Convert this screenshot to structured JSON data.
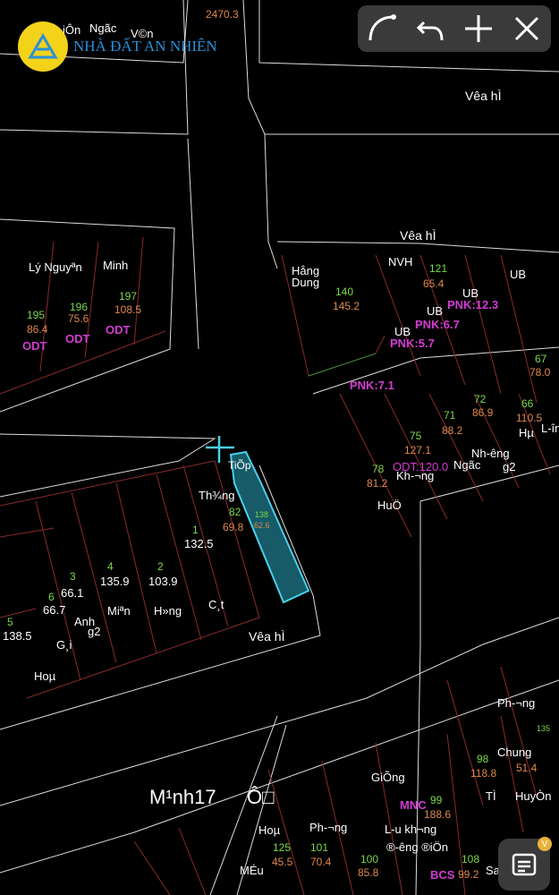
{
  "brand": {
    "logo_text": "NHÀ ĐẤT AN NHIÊN",
    "color": "#f3d21a"
  },
  "toolbar": {
    "icons": [
      "curve-icon",
      "undo-icon",
      "plus-icon",
      "close-icon"
    ]
  },
  "notes": {
    "badge": "V"
  },
  "map": {
    "road_labels": [
      "Vêa hÌ",
      "Vêa hÌ",
      "Vêa hÌ"
    ],
    "place_label": "M¹nh17",
    "place_label2": "Ô□",
    "labels": [
      {
        "t": "2470.3",
        "c": "o"
      },
      {
        "t": "Ngãc",
        "c": "w"
      },
      {
        "t": "V©n",
        "c": "w"
      },
      {
        "t": "iÔn",
        "c": "w"
      },
      {
        "t": "Lý Nguyªn",
        "c": "w"
      },
      {
        "t": "Minh",
        "c": "w"
      },
      {
        "t": "197",
        "c": "g"
      },
      {
        "t": "108.5",
        "c": "o"
      },
      {
        "t": "196",
        "c": "g"
      },
      {
        "t": "75.6",
        "c": "o"
      },
      {
        "t": "195",
        "c": "g"
      },
      {
        "t": "86.4",
        "c": "o"
      },
      {
        "t": "ODT",
        "c": "ml"
      },
      {
        "t": "ODT",
        "c": "ml"
      },
      {
        "t": "ODT",
        "c": "ml"
      },
      {
        "t": "Hång Dung",
        "c": "w"
      },
      {
        "t": "NVH",
        "c": "w"
      },
      {
        "t": "121",
        "c": "g"
      },
      {
        "t": "65.4",
        "c": "o"
      },
      {
        "t": "140",
        "c": "g"
      },
      {
        "t": "145.2",
        "c": "o"
      },
      {
        "t": "UB",
        "c": "w"
      },
      {
        "t": "UB",
        "c": "w"
      },
      {
        "t": "UB",
        "c": "w"
      },
      {
        "t": "UB",
        "c": "w"
      },
      {
        "t": "PNK:12.3",
        "c": "ml"
      },
      {
        "t": "PNK:6.7",
        "c": "ml"
      },
      {
        "t": "PNK:5.7",
        "c": "ml"
      },
      {
        "t": "PNK:7.1",
        "c": "ml"
      },
      {
        "t": "67",
        "c": "g"
      },
      {
        "t": "78.0",
        "c": "o"
      },
      {
        "t": "72",
        "c": "g"
      },
      {
        "t": "86.9",
        "c": "o"
      },
      {
        "t": "71",
        "c": "g"
      },
      {
        "t": "88.2",
        "c": "o"
      },
      {
        "t": "66",
        "c": "g"
      },
      {
        "t": "110.5",
        "c": "o"
      },
      {
        "t": "75",
        "c": "g"
      },
      {
        "t": "127.1",
        "c": "o"
      },
      {
        "t": "78",
        "c": "g"
      },
      {
        "t": "81.2",
        "c": "o"
      },
      {
        "t": "ODT:120.0",
        "c": "ml"
      },
      {
        "t": "Nh-êng",
        "c": "w"
      },
      {
        "t": "Ngãc",
        "c": "w"
      },
      {
        "t": "g2",
        "c": "w"
      },
      {
        "t": "Kh-¬ng",
        "c": "w"
      },
      {
        "t": "HuÖ",
        "c": "w"
      },
      {
        "t": "L-în",
        "c": "w"
      },
      {
        "t": "Hµ",
        "c": "w"
      },
      {
        "t": "TiÕp",
        "c": "w"
      },
      {
        "t": "Th¾ng",
        "c": "w"
      },
      {
        "t": "82",
        "c": "g"
      },
      {
        "t": "69.8",
        "c": "o"
      },
      {
        "t": "138",
        "c": "g"
      },
      {
        "t": "62.6",
        "c": "o"
      },
      {
        "t": "1",
        "c": "g"
      },
      {
        "t": "132.5",
        "c": "w"
      },
      {
        "t": "2",
        "c": "g"
      },
      {
        "t": "103.9",
        "c": "w"
      },
      {
        "t": "4",
        "c": "g"
      },
      {
        "t": "135.9",
        "c": "w"
      },
      {
        "t": "3",
        "c": "g"
      },
      {
        "t": "66.1",
        "c": "w"
      },
      {
        "t": "6",
        "c": "g"
      },
      {
        "t": "66.7",
        "c": "w"
      },
      {
        "t": "5",
        "c": "g"
      },
      {
        "t": "138.5",
        "c": "w"
      },
      {
        "t": "Anh",
        "c": "w"
      },
      {
        "t": "g2",
        "c": "w"
      },
      {
        "t": "Miªn",
        "c": "w"
      },
      {
        "t": "H»ng",
        "c": "w"
      },
      {
        "t": "C¸t",
        "c": "w"
      },
      {
        "t": "G¸i",
        "c": "w"
      },
      {
        "t": "Hoµ",
        "c": "w"
      },
      {
        "t": "GiÕng",
        "c": "w"
      },
      {
        "t": "99",
        "c": "g"
      },
      {
        "t": "188.6",
        "c": "o"
      },
      {
        "t": "98",
        "c": "g"
      },
      {
        "t": "118.8",
        "c": "o"
      },
      {
        "t": "135",
        "c": "g"
      },
      {
        "t": "51.4",
        "c": "o"
      },
      {
        "t": "Ph-¬ng",
        "c": "w"
      },
      {
        "t": "Chung",
        "c": "w"
      },
      {
        "t": "TÌ",
        "c": "w"
      },
      {
        "t": "HuyÒn",
        "c": "w"
      },
      {
        "t": "L-u kh¬ng",
        "c": "w"
      },
      {
        "t": "®-êng ®iÖn",
        "c": "w"
      },
      {
        "t": "125",
        "c": "g"
      },
      {
        "t": "45.5",
        "c": "o"
      },
      {
        "t": "101",
        "c": "g"
      },
      {
        "t": "70.4",
        "c": "o"
      },
      {
        "t": "100",
        "c": "g"
      },
      {
        "t": "85.8",
        "c": "o"
      },
      {
        "t": "108",
        "c": "g"
      },
      {
        "t": "99.2",
        "c": "o"
      },
      {
        "t": "BCS",
        "c": "ml"
      },
      {
        "t": "MNC",
        "c": "ml"
      },
      {
        "t": "MÉu",
        "c": "w"
      },
      {
        "t": "Hoµ",
        "c": "w"
      },
      {
        "t": "Ph-¬ng",
        "c": "w"
      },
      {
        "t": "Sa",
        "c": "w"
      }
    ]
  }
}
